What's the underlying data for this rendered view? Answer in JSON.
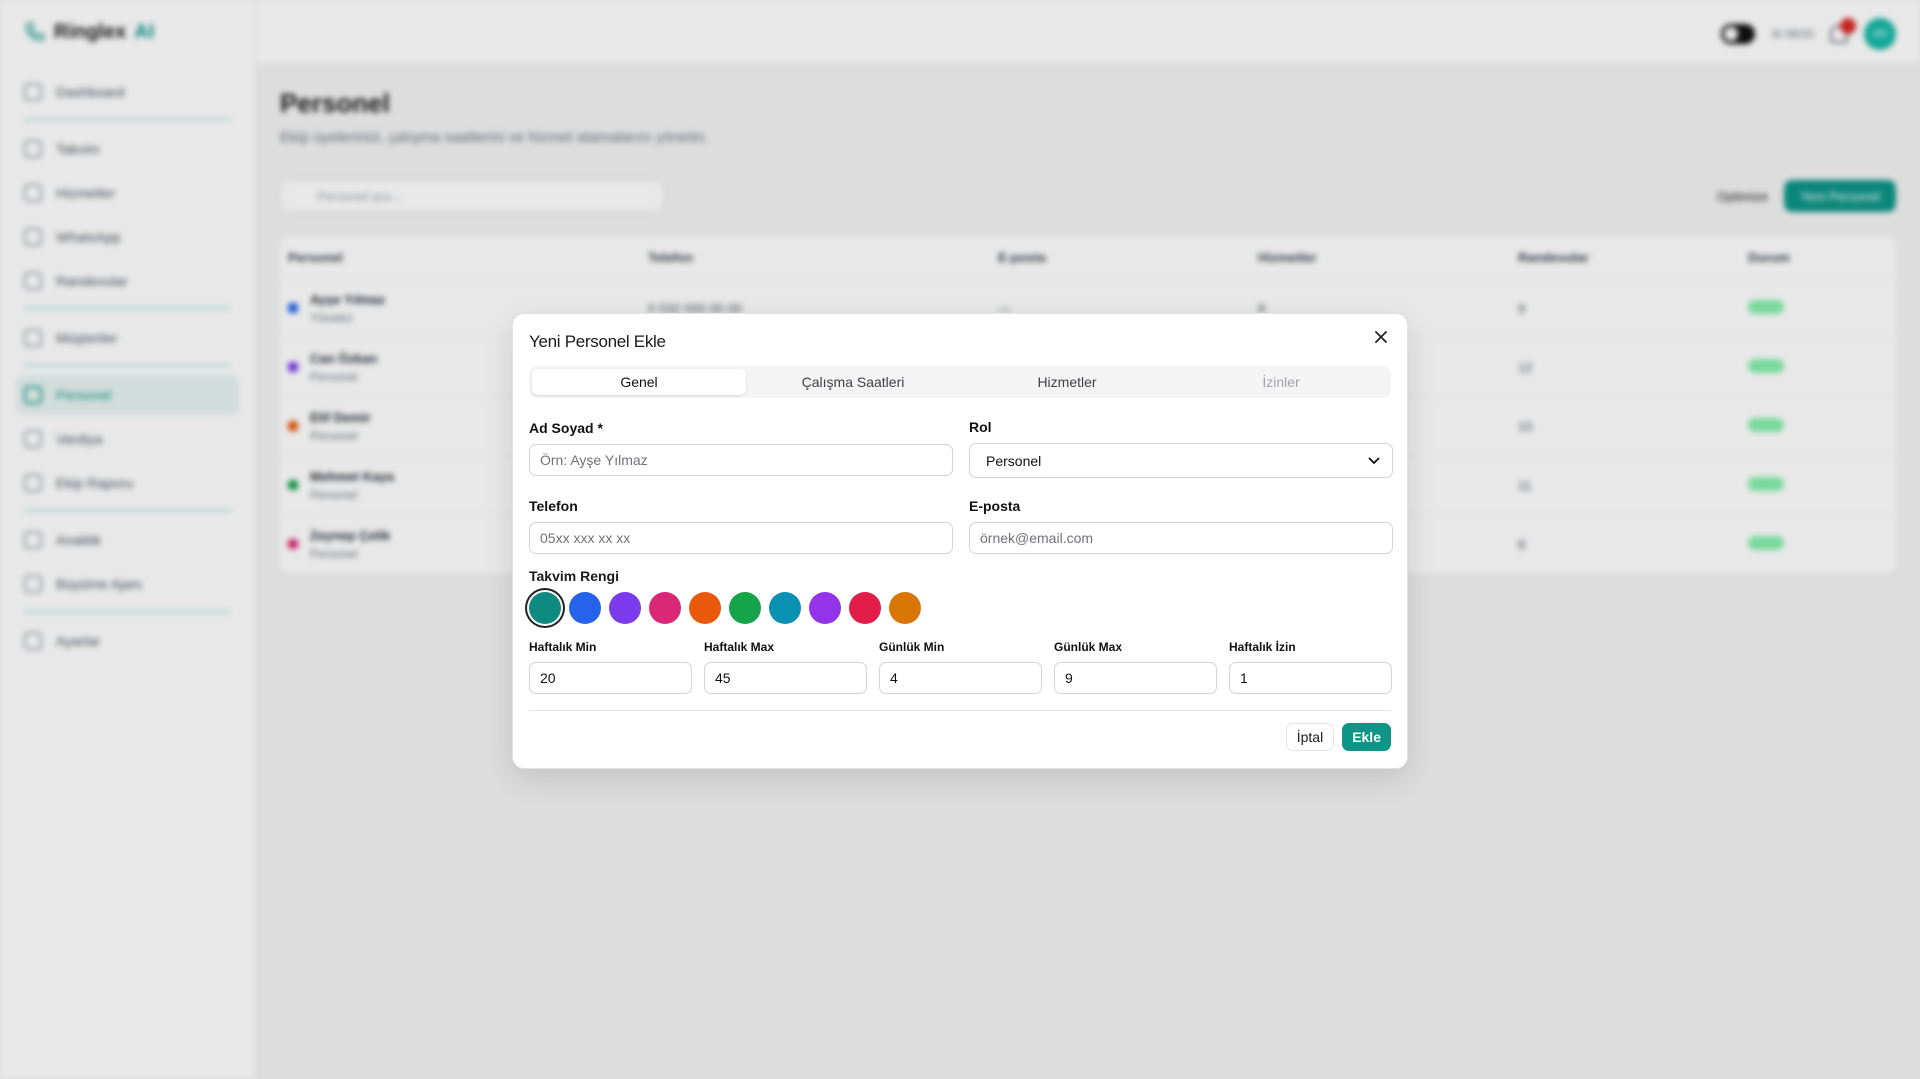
{
  "app": {
    "brand_name": "Ringlex",
    "brand_suffix": "AI",
    "header": {
      "mode_label": "AI MOD",
      "avatar_initials": "AD"
    },
    "sidebar": {
      "items": [
        {
          "label": "Dashboard"
        },
        {
          "label": "Takvim"
        },
        {
          "label": "Hizmetler"
        },
        {
          "label": "WhatsApp"
        },
        {
          "label": "Randevular"
        },
        {
          "label": "Müşteriler"
        },
        {
          "label": "Personel"
        },
        {
          "label": "Vardiya"
        },
        {
          "label": "Ekip Raporu"
        },
        {
          "label": "Analitik"
        },
        {
          "label": "Büyüme Ajanı"
        },
        {
          "label": "Ayarlar"
        }
      ]
    },
    "page": {
      "title": "Personel",
      "subtitle": "Ekip üyelerinizi, çalışma saatlerini ve hizmet atamalarını yönetin.",
      "search_placeholder": "Personel ara...",
      "optimize_label": "Optimize",
      "new_button": "Yeni Personel",
      "columns": [
        "Personel",
        "Telefon",
        "E-posta",
        "Hizmetler",
        "Randevular",
        "Durum",
        ""
      ],
      "rows": [
        {
          "name": "Ayşe Yılmaz",
          "role": "Yönetici",
          "phone": "0 532 000 00 00",
          "email": "—",
          "services": "8",
          "appointments": "9",
          "status": "Aktif",
          "color": "#2563eb"
        },
        {
          "name": "Can Özkan",
          "role": "Personel",
          "phone": "",
          "email": "",
          "services": "",
          "appointments": "12",
          "status": "Aktif",
          "color": "#7c3aed"
        },
        {
          "name": "Elif Demir",
          "role": "Personel",
          "phone": "",
          "email": "",
          "services": "",
          "appointments": "10",
          "status": "Aktif",
          "color": "#ea580c"
        },
        {
          "name": "Mehmet Kaya",
          "role": "Personel",
          "phone": "",
          "email": "",
          "services": "",
          "appointments": "11",
          "status": "Aktif",
          "color": "#16a34a"
        },
        {
          "name": "Zeynep Çelik",
          "role": "Personel",
          "phone": "",
          "email": "",
          "services": "",
          "appointments": "8",
          "status": "Aktif",
          "color": "#db2777"
        }
      ]
    }
  },
  "dialog": {
    "title": "Yeni Personel Ekle",
    "tabs": [
      {
        "label": "Genel"
      },
      {
        "label": "Çalışma Saatleri"
      },
      {
        "label": "Hizmetler"
      },
      {
        "label": "İzinler"
      }
    ],
    "fields": {
      "name_label": "Ad Soyad *",
      "name_placeholder": "Örn: Ayşe Yılmaz",
      "role_label": "Rol",
      "role_value": "Personel",
      "phone_label": "Telefon",
      "phone_placeholder": "05xx xxx xx xx",
      "email_label": "E-posta",
      "email_placeholder": "örnek@email.com"
    },
    "calendar_color_label": "Takvim Rengi",
    "colors": [
      "#0f8a80",
      "#2563eb",
      "#7c3aed",
      "#db2777",
      "#ea580c",
      "#16a34a",
      "#0891b2",
      "#9333ea",
      "#e11d48",
      "#d97706"
    ],
    "selected_color_index": 0,
    "limits": [
      {
        "label": "Haftalık Min",
        "value": "20"
      },
      {
        "label": "Haftalık Max",
        "value": "45"
      },
      {
        "label": "Günlük Min",
        "value": "4"
      },
      {
        "label": "Günlük Max",
        "value": "9"
      },
      {
        "label": "Haftalık İzin",
        "value": "1"
      }
    ],
    "cancel_label": "İptal",
    "submit_label": "Ekle"
  }
}
